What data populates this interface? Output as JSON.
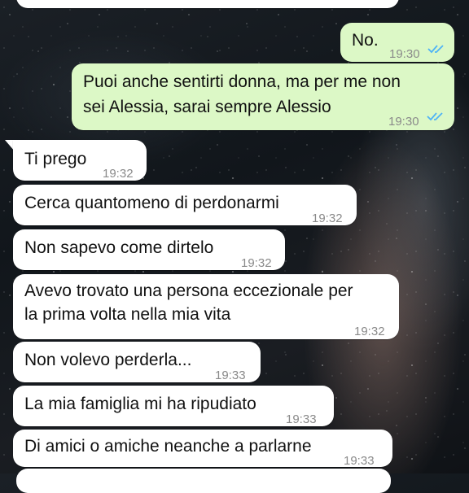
{
  "messages": [
    {
      "text": "No.",
      "time": "19:30",
      "direction": "outgoing",
      "read": true
    },
    {
      "text_lines": [
        "Puoi anche sentirti donna, ma per me non",
        "sei Alessia, sarai sempre Alessio"
      ],
      "time": "19:30",
      "direction": "outgoing",
      "read": true
    },
    {
      "text": "Ti prego",
      "time": "19:32",
      "direction": "incoming"
    },
    {
      "text": "Cerca quantomeno di perdonarmi",
      "time": "19:32",
      "direction": "incoming"
    },
    {
      "text": "Non sapevo come dirtelo",
      "time": "19:32",
      "direction": "incoming"
    },
    {
      "text_lines": [
        "Avevo trovato una persona eccezionale per",
        "la prima volta nella mia vita"
      ],
      "time": "19:32",
      "direction": "incoming"
    },
    {
      "text": "Non volevo perderla...",
      "time": "19:33",
      "direction": "incoming"
    },
    {
      "text": "La mia famiglia mi ha ripudiato",
      "time": "19:33",
      "direction": "incoming"
    },
    {
      "text": "Di amici o amiche neanche a parlarne",
      "time": "19:33",
      "direction": "incoming"
    }
  ],
  "colors": {
    "incoming_bubble": "#ffffff",
    "outgoing_bubble": "#dcf8c6",
    "read_ticks": "#4fb3f6",
    "timestamp": "#8a8a8a"
  },
  "icons": {
    "read_receipt": "double-check-icon"
  }
}
